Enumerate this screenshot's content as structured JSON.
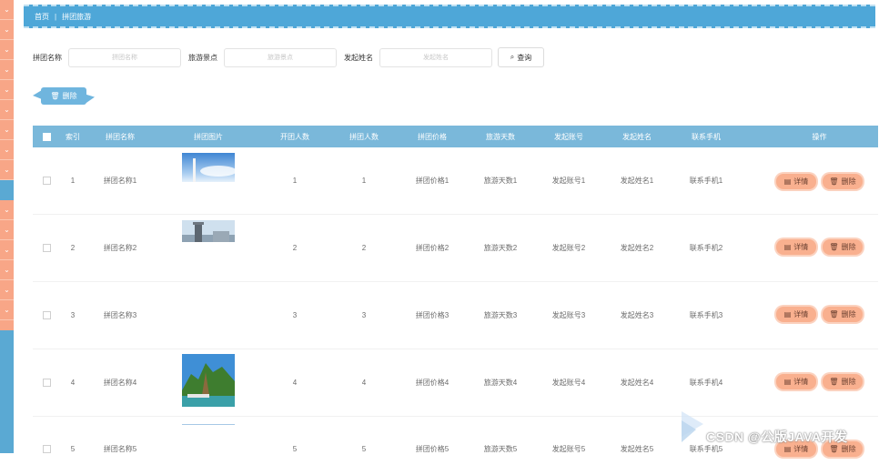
{
  "sidebar": {
    "arrow": "⌄"
  },
  "breadcrumb": {
    "home": "首页",
    "current": "拼团旅游"
  },
  "search": {
    "fields": [
      {
        "label": "拼团名称",
        "placeholder": "拼团名称"
      },
      {
        "label": "旅游景点",
        "placeholder": "旅游景点"
      },
      {
        "label": "发起姓名",
        "placeholder": "发起姓名"
      }
    ],
    "query_label": "查询"
  },
  "toolbar": {
    "delete_label": "删除"
  },
  "table": {
    "headers": [
      "索引",
      "拼团名称",
      "拼团图片",
      "开团人数",
      "拼团人数",
      "拼团价格",
      "旅游天数",
      "发起账号",
      "发起姓名",
      "联系手机",
      "操作"
    ],
    "rows": [
      {
        "index": "1",
        "name": "拼团名称1",
        "open": "1",
        "join": "1",
        "price": "拼团价格1",
        "days": "旅游天数1",
        "account": "发起账号1",
        "starter": "发起姓名1",
        "phone": "联系手机1"
      },
      {
        "index": "2",
        "name": "拼团名称2",
        "open": "2",
        "join": "2",
        "price": "拼团价格2",
        "days": "旅游天数2",
        "account": "发起账号2",
        "starter": "发起姓名2",
        "phone": "联系手机2"
      },
      {
        "index": "3",
        "name": "拼团名称3",
        "open": "3",
        "join": "3",
        "price": "拼团价格3",
        "days": "旅游天数3",
        "account": "发起账号3",
        "starter": "发起姓名3",
        "phone": "联系手机3"
      },
      {
        "index": "4",
        "name": "拼团名称4",
        "open": "4",
        "join": "4",
        "price": "拼团价格4",
        "days": "旅游天数4",
        "account": "发起账号4",
        "starter": "发起姓名4",
        "phone": "联系手机4"
      },
      {
        "index": "5",
        "name": "拼团名称5",
        "open": "5",
        "join": "5",
        "price": "拼团价格5",
        "days": "旅游天数5",
        "account": "发起账号5",
        "starter": "发起姓名5",
        "phone": "联系手机5"
      }
    ],
    "detail_label": "详情",
    "delete_label": "删除"
  },
  "watermark": "CSDN @公版JAVA开发",
  "colors": {
    "primary": "#4ea7d8",
    "header": "#7ab8da",
    "action": "#f9b08f",
    "sidebar": "#f8a687"
  }
}
